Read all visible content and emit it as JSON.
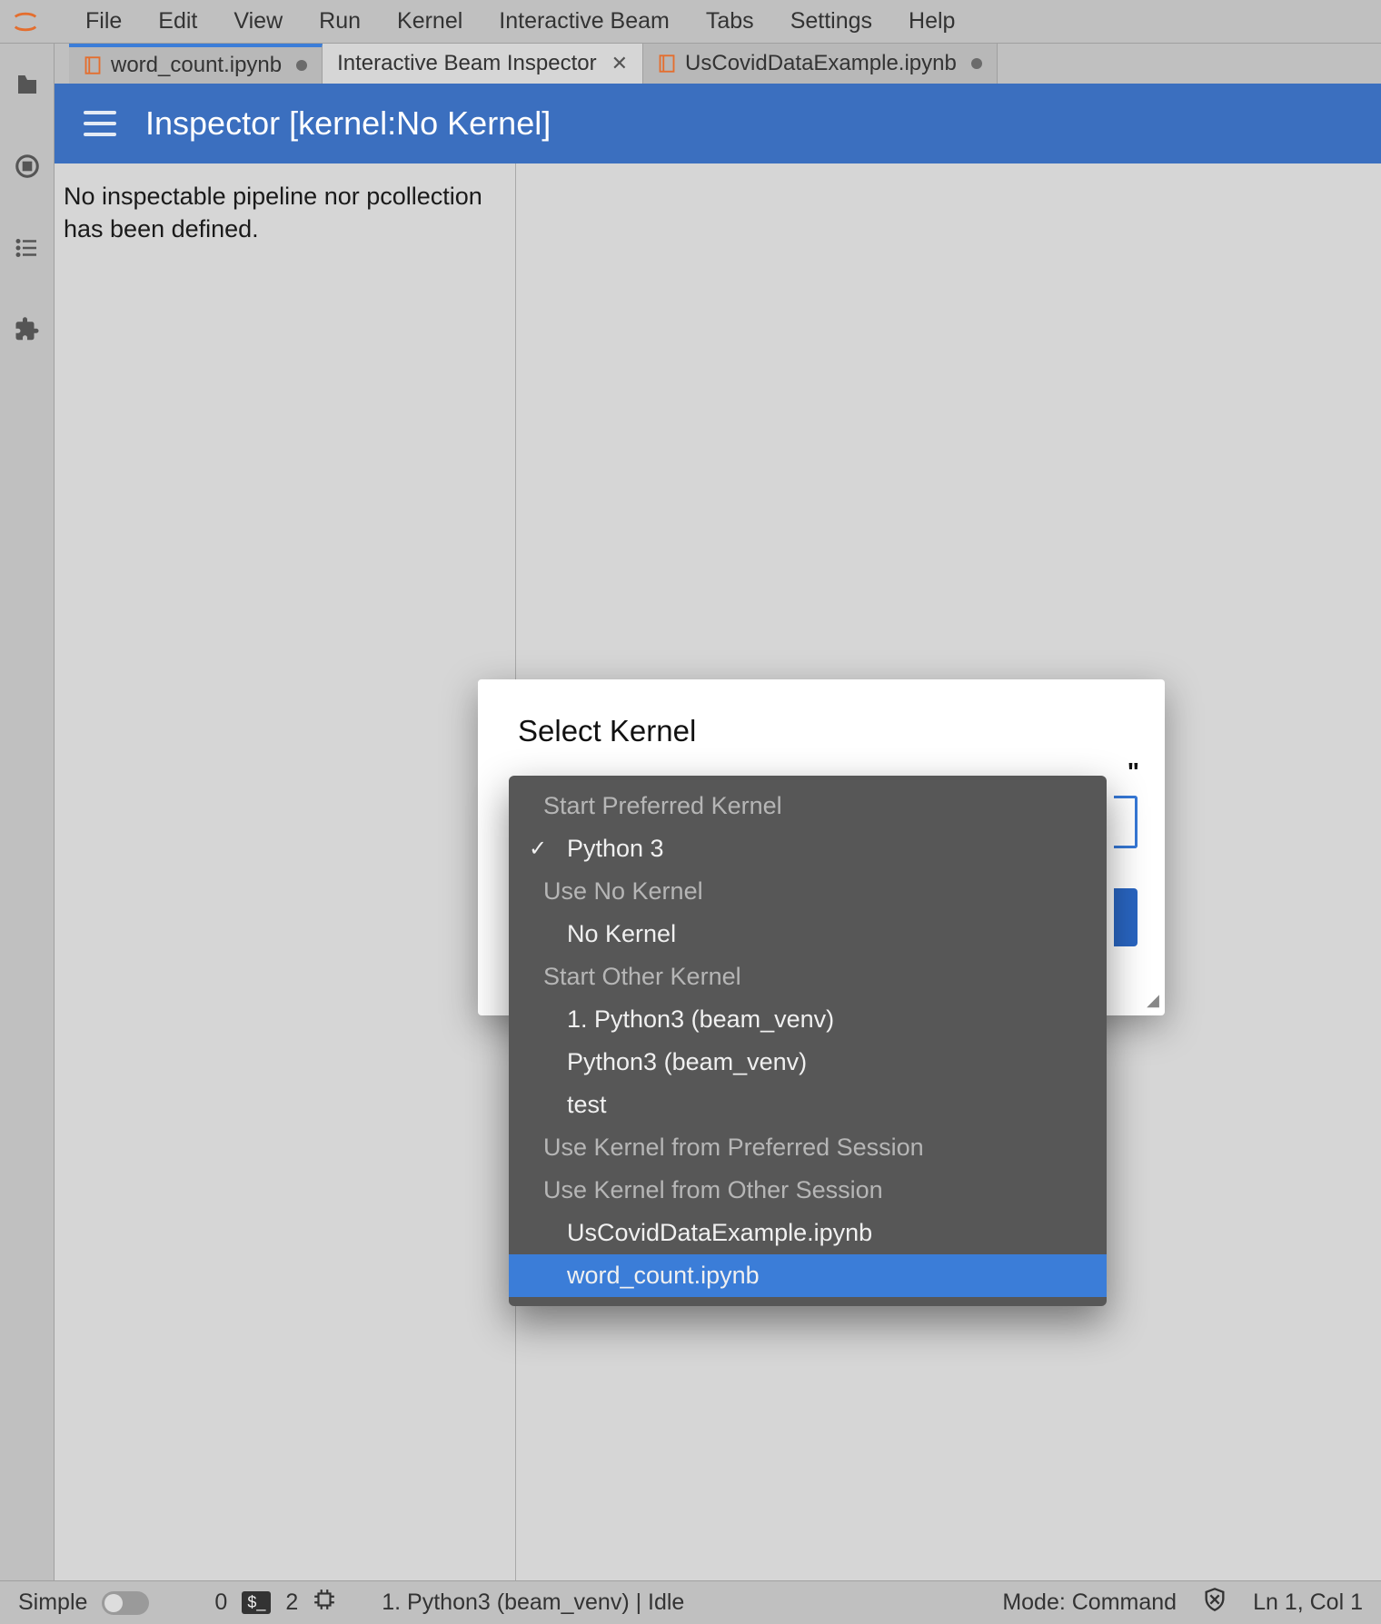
{
  "menubar": {
    "items": [
      "File",
      "Edit",
      "View",
      "Run",
      "Kernel",
      "Interactive Beam",
      "Tabs",
      "Settings",
      "Help"
    ]
  },
  "tabs": [
    {
      "label": "word_count.ipynb",
      "dirty": true,
      "notebook_icon": true
    },
    {
      "label": "Interactive Beam Inspector",
      "closeable": true
    },
    {
      "label": "UsCovidDataExample.ipynb",
      "dirty": true,
      "notebook_icon": true
    }
  ],
  "inspector": {
    "title": "Inspector [kernel:No Kernel]",
    "empty_message": "No inspectable pipeline nor pcollection has been defined."
  },
  "dialog": {
    "title": "Select Kernel",
    "trailing_quote": "\""
  },
  "kernel_menu": {
    "groups": [
      {
        "header": "Start Preferred Kernel",
        "items": [
          {
            "label": "Python 3",
            "checked": true
          }
        ]
      },
      {
        "header": "Use No Kernel",
        "items": [
          {
            "label": "No Kernel"
          }
        ]
      },
      {
        "header": "Start Other Kernel",
        "items": [
          {
            "label": "1. Python3 (beam_venv)"
          },
          {
            "label": "Python3 (beam_venv)"
          },
          {
            "label": "test"
          }
        ]
      },
      {
        "header": "Use Kernel from Preferred Session",
        "items": []
      },
      {
        "header": "Use Kernel from Other Session",
        "items": [
          {
            "label": "UsCovidDataExample.ipynb"
          },
          {
            "label": "word_count.ipynb",
            "selected": true
          }
        ]
      }
    ]
  },
  "statusbar": {
    "simple_label": "Simple",
    "terminals_count": "0",
    "sessions_count": "2",
    "kernel_status": "1. Python3 (beam_venv) | Idle",
    "mode": "Mode: Command",
    "position": "Ln 1, Col 1"
  }
}
